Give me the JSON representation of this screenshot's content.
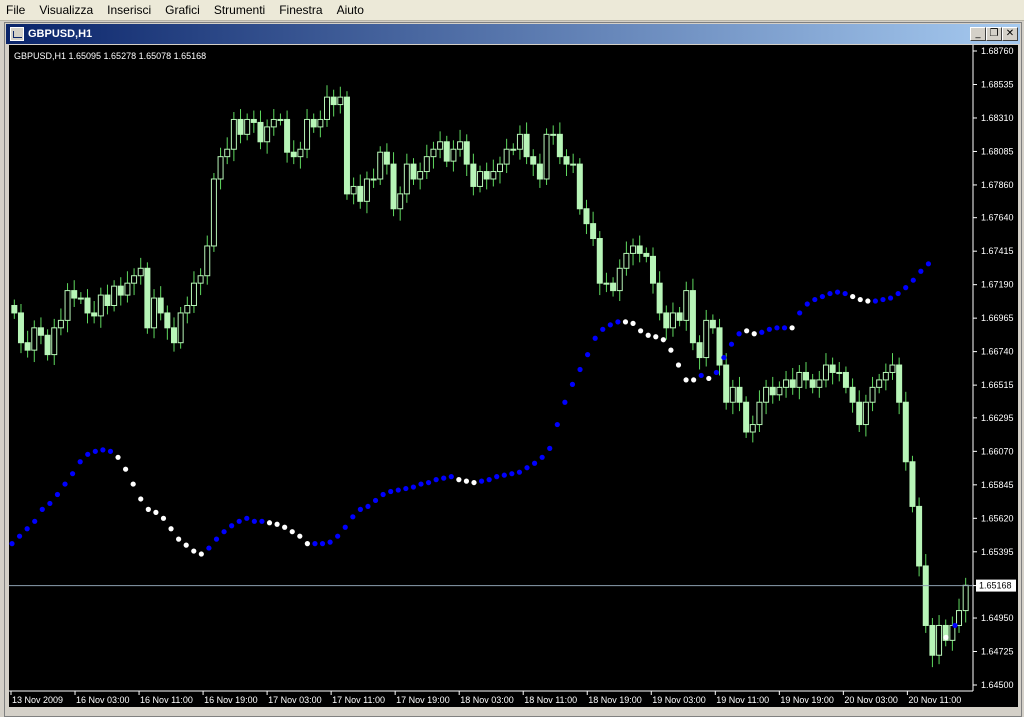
{
  "menu": {
    "items": [
      {
        "id": "file",
        "label": "File"
      },
      {
        "id": "visualizza",
        "label": "Visualizza"
      },
      {
        "id": "inserisci",
        "label": "Inserisci"
      },
      {
        "id": "grafici",
        "label": "Grafici"
      },
      {
        "id": "strumenti",
        "label": "Strumenti"
      },
      {
        "id": "finestra",
        "label": "Finestra"
      },
      {
        "id": "aiuto",
        "label": "Aiuto"
      }
    ]
  },
  "window": {
    "title": "GBPUSD,H1",
    "minimize_icon": "minimize-icon",
    "maximize_icon": "restore-icon",
    "close_icon": "close-icon"
  },
  "chart_header": "GBPUSD,H1  1.65095 1.65278 1.65078 1.65168",
  "chart_data": {
    "type": "candlestick",
    "symbol": "GBPUSD",
    "timeframe": "H1",
    "colors": {
      "background": "#000000",
      "candle": "#b8f5b8",
      "wick": "#5fd95f",
      "dot_up": "#0000ff",
      "dot_down": "#ffffff",
      "grid_line": "#8da0b0",
      "price_tag_bg": "#ffffff"
    },
    "current_price": "1.65168",
    "y_range": [
      1.645,
      1.6876
    ],
    "y_ticks": [
      "1.68760",
      "1.68535",
      "1.68310",
      "1.68085",
      "1.67860",
      "1.67640",
      "1.67415",
      "1.67190",
      "1.66965",
      "1.66740",
      "1.66515",
      "1.66295",
      "1.66070",
      "1.65845",
      "1.65620",
      "1.65395",
      "1.65168",
      "1.64950",
      "1.64725",
      "1.64500"
    ],
    "x_ticks": [
      "13 Nov 2009",
      "16 Nov 03:00",
      "16 Nov 11:00",
      "16 Nov 19:00",
      "17 Nov 03:00",
      "17 Nov 11:00",
      "17 Nov 19:00",
      "18 Nov 03:00",
      "18 Nov 11:00",
      "18 Nov 19:00",
      "19 Nov 03:00",
      "19 Nov 11:00",
      "19 Nov 19:00",
      "20 Nov 03:00",
      "20 Nov 11:00"
    ],
    "close": [
      1.67,
      1.668,
      1.6675,
      1.669,
      1.6685,
      1.6672,
      1.669,
      1.6695,
      1.6715,
      1.671,
      1.671,
      1.67,
      1.6698,
      1.6712,
      1.6705,
      1.6718,
      1.6712,
      1.672,
      1.6725,
      1.673,
      1.669,
      1.671,
      1.67,
      1.669,
      1.668,
      1.67,
      1.6705,
      1.672,
      1.6725,
      1.6745,
      1.679,
      1.6805,
      1.681,
      1.683,
      1.682,
      1.683,
      1.6828,
      1.6815,
      1.6825,
      1.683,
      1.683,
      1.6808,
      1.6805,
      1.681,
      1.683,
      1.6825,
      1.683,
      1.6845,
      1.684,
      1.6845,
      1.678,
      1.6785,
      1.6775,
      1.679,
      1.679,
      1.6808,
      1.68,
      1.677,
      1.678,
      1.68,
      1.679,
      1.6795,
      1.6805,
      1.681,
      1.6815,
      1.6802,
      1.681,
      1.6815,
      1.68,
      1.6785,
      1.6795,
      1.679,
      1.6795,
      1.68,
      1.681,
      1.681,
      1.682,
      1.6805,
      1.68,
      1.679,
      1.682,
      1.682,
      1.6805,
      1.68,
      1.68,
      1.677,
      1.676,
      1.675,
      1.672,
      1.672,
      1.6715,
      1.673,
      1.674,
      1.6745,
      1.674,
      1.6738,
      1.672,
      1.67,
      1.669,
      1.67,
      1.6695,
      1.6715,
      1.668,
      1.667,
      1.6695,
      1.669,
      1.6665,
      1.664,
      1.665,
      1.664,
      1.662,
      1.6625,
      1.664,
      1.665,
      1.6645,
      1.665,
      1.6655,
      1.665,
      1.666,
      1.6655,
      1.665,
      1.6655,
      1.6665,
      1.666,
      1.666,
      1.665,
      1.664,
      1.6625,
      1.664,
      1.665,
      1.6655,
      1.666,
      1.6665,
      1.664,
      1.66,
      1.657,
      1.653,
      1.649,
      1.647,
      1.649,
      1.648,
      1.649,
      1.65,
      1.6517
    ],
    "dots": [
      {
        "v": 1.6545,
        "c": "up"
      },
      {
        "v": 1.655,
        "c": "up"
      },
      {
        "v": 1.6555,
        "c": "up"
      },
      {
        "v": 1.656,
        "c": "up"
      },
      {
        "v": 1.6568,
        "c": "up"
      },
      {
        "v": 1.6572,
        "c": "up"
      },
      {
        "v": 1.6578,
        "c": "up"
      },
      {
        "v": 1.6585,
        "c": "up"
      },
      {
        "v": 1.6592,
        "c": "up"
      },
      {
        "v": 1.66,
        "c": "up"
      },
      {
        "v": 1.6605,
        "c": "up"
      },
      {
        "v": 1.6607,
        "c": "up"
      },
      {
        "v": 1.6608,
        "c": "up"
      },
      {
        "v": 1.6607,
        "c": "up"
      },
      {
        "v": 1.6603,
        "c": "down"
      },
      {
        "v": 1.6595,
        "c": "down"
      },
      {
        "v": 1.6585,
        "c": "down"
      },
      {
        "v": 1.6575,
        "c": "down"
      },
      {
        "v": 1.6568,
        "c": "down"
      },
      {
        "v": 1.6566,
        "c": "down"
      },
      {
        "v": 1.6562,
        "c": "down"
      },
      {
        "v": 1.6555,
        "c": "down"
      },
      {
        "v": 1.6548,
        "c": "down"
      },
      {
        "v": 1.6544,
        "c": "down"
      },
      {
        "v": 1.654,
        "c": "down"
      },
      {
        "v": 1.6538,
        "c": "down"
      },
      {
        "v": 1.6542,
        "c": "up"
      },
      {
        "v": 1.6548,
        "c": "up"
      },
      {
        "v": 1.6553,
        "c": "up"
      },
      {
        "v": 1.6557,
        "c": "up"
      },
      {
        "v": 1.656,
        "c": "up"
      },
      {
        "v": 1.6562,
        "c": "up"
      },
      {
        "v": 1.656,
        "c": "up"
      },
      {
        "v": 1.656,
        "c": "up"
      },
      {
        "v": 1.6559,
        "c": "down"
      },
      {
        "v": 1.6558,
        "c": "down"
      },
      {
        "v": 1.6556,
        "c": "down"
      },
      {
        "v": 1.6553,
        "c": "down"
      },
      {
        "v": 1.655,
        "c": "down"
      },
      {
        "v": 1.6545,
        "c": "down"
      },
      {
        "v": 1.6545,
        "c": "up"
      },
      {
        "v": 1.6545,
        "c": "up"
      },
      {
        "v": 1.6546,
        "c": "up"
      },
      {
        "v": 1.655,
        "c": "up"
      },
      {
        "v": 1.6556,
        "c": "up"
      },
      {
        "v": 1.6563,
        "c": "up"
      },
      {
        "v": 1.6568,
        "c": "up"
      },
      {
        "v": 1.657,
        "c": "up"
      },
      {
        "v": 1.6574,
        "c": "up"
      },
      {
        "v": 1.6578,
        "c": "up"
      },
      {
        "v": 1.658,
        "c": "up"
      },
      {
        "v": 1.6581,
        "c": "up"
      },
      {
        "v": 1.6582,
        "c": "up"
      },
      {
        "v": 1.6583,
        "c": "up"
      },
      {
        "v": 1.6585,
        "c": "up"
      },
      {
        "v": 1.6586,
        "c": "up"
      },
      {
        "v": 1.6588,
        "c": "up"
      },
      {
        "v": 1.6589,
        "c": "up"
      },
      {
        "v": 1.659,
        "c": "up"
      },
      {
        "v": 1.6588,
        "c": "down"
      },
      {
        "v": 1.6587,
        "c": "down"
      },
      {
        "v": 1.6586,
        "c": "down"
      },
      {
        "v": 1.6587,
        "c": "up"
      },
      {
        "v": 1.6588,
        "c": "up"
      },
      {
        "v": 1.659,
        "c": "up"
      },
      {
        "v": 1.6591,
        "c": "up"
      },
      {
        "v": 1.6592,
        "c": "up"
      },
      {
        "v": 1.6593,
        "c": "up"
      },
      {
        "v": 1.6596,
        "c": "up"
      },
      {
        "v": 1.6599,
        "c": "up"
      },
      {
        "v": 1.6603,
        "c": "up"
      },
      {
        "v": 1.6609,
        "c": "up"
      },
      {
        "v": 1.6625,
        "c": "up"
      },
      {
        "v": 1.664,
        "c": "up"
      },
      {
        "v": 1.6652,
        "c": "up"
      },
      {
        "v": 1.6662,
        "c": "up"
      },
      {
        "v": 1.6672,
        "c": "up"
      },
      {
        "v": 1.6683,
        "c": "up"
      },
      {
        "v": 1.6689,
        "c": "up"
      },
      {
        "v": 1.6692,
        "c": "up"
      },
      {
        "v": 1.6694,
        "c": "up"
      },
      {
        "v": 1.6694,
        "c": "down"
      },
      {
        "v": 1.6693,
        "c": "down"
      },
      {
        "v": 1.6688,
        "c": "down"
      },
      {
        "v": 1.6685,
        "c": "down"
      },
      {
        "v": 1.6684,
        "c": "down"
      },
      {
        "v": 1.6682,
        "c": "down"
      },
      {
        "v": 1.6675,
        "c": "down"
      },
      {
        "v": 1.6665,
        "c": "down"
      },
      {
        "v": 1.6655,
        "c": "down"
      },
      {
        "v": 1.6655,
        "c": "down"
      },
      {
        "v": 1.6658,
        "c": "up"
      },
      {
        "v": 1.6656,
        "c": "down"
      },
      {
        "v": 1.666,
        "c": "up"
      },
      {
        "v": 1.667,
        "c": "up"
      },
      {
        "v": 1.6679,
        "c": "up"
      },
      {
        "v": 1.6686,
        "c": "up"
      },
      {
        "v": 1.6688,
        "c": "down"
      },
      {
        "v": 1.6686,
        "c": "down"
      },
      {
        "v": 1.6687,
        "c": "up"
      },
      {
        "v": 1.6689,
        "c": "up"
      },
      {
        "v": 1.669,
        "c": "up"
      },
      {
        "v": 1.669,
        "c": "up"
      },
      {
        "v": 1.669,
        "c": "down"
      },
      {
        "v": 1.67,
        "c": "up"
      },
      {
        "v": 1.6706,
        "c": "up"
      },
      {
        "v": 1.6709,
        "c": "up"
      },
      {
        "v": 1.6711,
        "c": "up"
      },
      {
        "v": 1.6713,
        "c": "up"
      },
      {
        "v": 1.6714,
        "c": "up"
      },
      {
        "v": 1.6713,
        "c": "up"
      },
      {
        "v": 1.6711,
        "c": "down"
      },
      {
        "v": 1.6709,
        "c": "down"
      },
      {
        "v": 1.6708,
        "c": "down"
      },
      {
        "v": 1.6708,
        "c": "up"
      },
      {
        "v": 1.6709,
        "c": "up"
      },
      {
        "v": 1.671,
        "c": "up"
      },
      {
        "v": 1.6713,
        "c": "up"
      },
      {
        "v": 1.6717,
        "c": "up"
      },
      {
        "v": 1.6722,
        "c": "up"
      },
      {
        "v": 1.6728,
        "c": "up"
      },
      {
        "v": 1.6733,
        "c": "up"
      }
    ],
    "tail_dots": [
      {
        "v": 1.6482,
        "c": "down"
      },
      {
        "v": 1.649,
        "c": "up"
      }
    ]
  }
}
